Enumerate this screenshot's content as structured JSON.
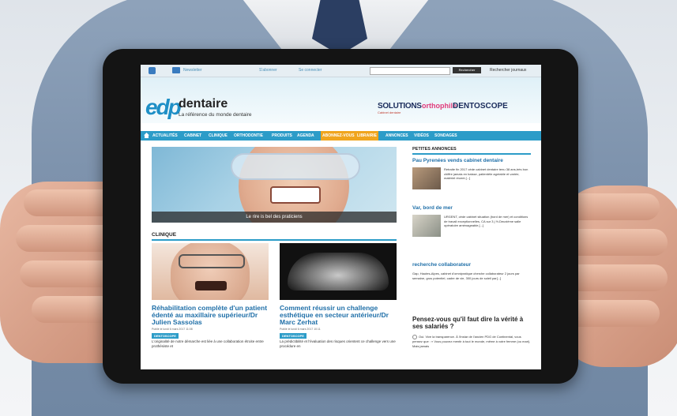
{
  "topbar": {
    "newsletter": "Newsletter",
    "register": "S'abonner",
    "login": "Se connecter",
    "search_button": "Rechercher",
    "search_journals": "Rechercher journaux"
  },
  "header": {
    "logo_mark": "edp",
    "logo_word": "dentaire",
    "tagline": "La référence du monde dentaire",
    "partner_solutions": "SOLUTIONS",
    "partner_solutions_sub": "Cabinet dentaire",
    "partner_orthophile": "orthophile",
    "partner_dentoscope": "DENTOSCOPE"
  },
  "nav": {
    "items": [
      "ACTUALITÉS",
      "CABINET",
      "CLINIQUE",
      "ORTHODONTIE",
      "PRODUITS",
      "AGENDA",
      "ABONNEZ-VOUS",
      "LIBRAIRIE",
      "ANNONCES",
      "VIDÉOS",
      "SONDAGES"
    ],
    "highlight_color": "#f0a51e",
    "bar_color": "#2c9cc8"
  },
  "hero": {
    "caption": "Le rire is bel des praticiens"
  },
  "section": {
    "title": "CLINIQUE"
  },
  "articles": [
    {
      "title": "Réhabilitation complète d'un patient édenté au maxillaire supérieur/Dr Julien Sassolas",
      "meta": "Publié le lundi 6 mars 2017 11:08",
      "badge": "DENTOSCOPE",
      "text": "L'originalité de notre démarche est liée à une collaboration étroite entre prothésiste et"
    },
    {
      "title": "Comment réussir un challenge esthétique en secteur antérieur/Dr Marc Zerhat",
      "meta": "Publié le lundi 6 mars 2017 10:11",
      "badge": "DENTOSCOPE",
      "text": "La prédictibilité et l'évaluation des risques orientent ce challenge vers une procédure en"
    }
  ],
  "sidebar": {
    "heading": "PETITES ANNONCES",
    "ads": [
      {
        "title": "Pau Pyrenées vends cabinet dentaire",
        "text": "Retraite fin 2017 cède cabinet dentaire tenu 38 ans,très bon chiffre jamais en baisse, patientèle agréable et variée, matériel récent.[...]"
      },
      {
        "title": "Var, bord de mer",
        "text": "URGENT, cède cabinet situation (bord de mer) et conditions de travail exceptionnelles, CA sur 3 j ½.Deuxième salle opératoire aménageable.[...]"
      },
      {
        "title": "recherche collaborateur",
        "text": "Gap, Hautes-Alpes, cabinet d'omnipratique cherche collaborateur 2 jours par semaine, gros potentiel, cadre de vie, 300 jours de soleil par[...]"
      }
    ],
    "poll_question": "Pensez-vous qu'il faut dire la vérité à ses salariés ?",
    "poll_answer": "Oui. Vive la transparence. À l'instar de l'ancien PDG de Continental, vous pensez que : « Vous pouvez mentir à tout le monde, même à votre femme (ou mari). Mais jamais"
  }
}
